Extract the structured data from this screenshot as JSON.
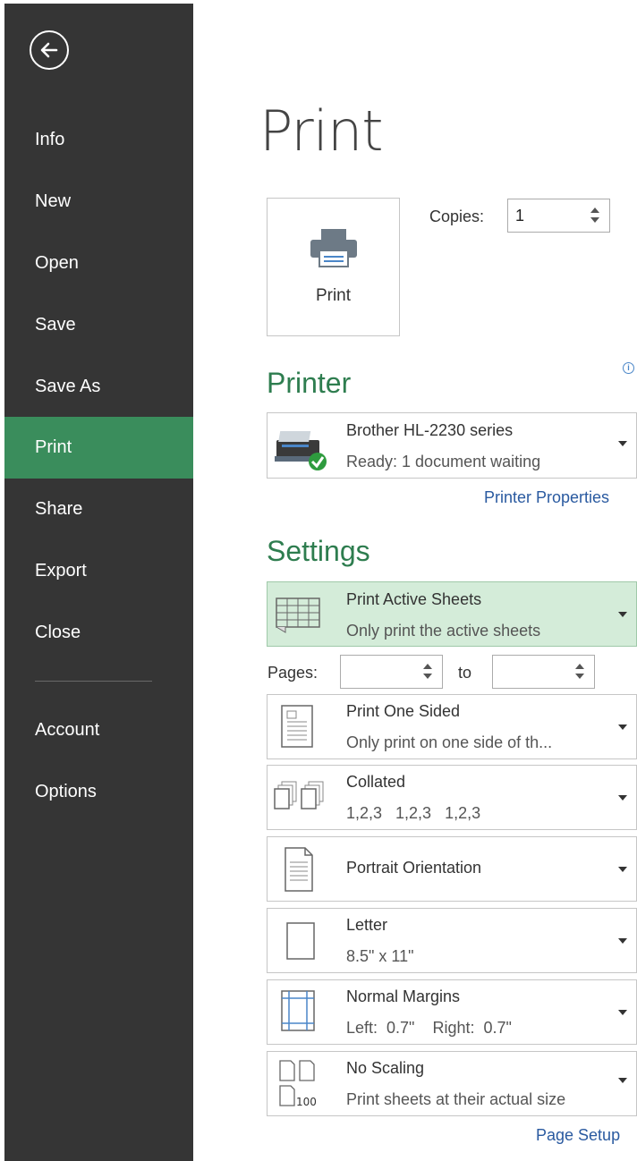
{
  "sidebar": {
    "items": [
      {
        "label": "Info"
      },
      {
        "label": "New"
      },
      {
        "label": "Open"
      },
      {
        "label": "Save"
      },
      {
        "label": "Save As"
      },
      {
        "label": "Print"
      },
      {
        "label": "Share"
      },
      {
        "label": "Export"
      },
      {
        "label": "Close"
      },
      {
        "label": "Account"
      },
      {
        "label": "Options"
      }
    ],
    "active": "Print"
  },
  "page": {
    "title": "Print"
  },
  "print_button": {
    "label": "Print"
  },
  "copies": {
    "label": "Copies:",
    "value": "1"
  },
  "printer": {
    "section_title": "Printer",
    "name": "Brother HL-2230 series",
    "status": "Ready: 1 document waiting",
    "properties_link": "Printer Properties"
  },
  "settings": {
    "section_title": "Settings",
    "active_sheets": {
      "title": "Print Active Sheets",
      "subtitle": "Only print the active sheets"
    },
    "pages": {
      "label": "Pages:",
      "to_label": "to",
      "from_value": "",
      "to_value": ""
    },
    "sided": {
      "title": "Print One Sided",
      "subtitle": "Only print on one side of th..."
    },
    "collated": {
      "title": "Collated",
      "subtitle": "1,2,3   1,2,3   1,2,3"
    },
    "orientation": {
      "title": "Portrait Orientation"
    },
    "paper": {
      "title": "Letter",
      "subtitle": "8.5\" x 11\""
    },
    "margins": {
      "title": "Normal Margins",
      "subtitle": "Left:  0.7\"    Right:  0.7\""
    },
    "scaling": {
      "title": "No Scaling",
      "subtitle": "Print sheets at their actual size",
      "icon_number": "100"
    },
    "page_setup_link": "Page Setup"
  },
  "colors": {
    "sidebar_bg": "#353535",
    "active_item": "#3a8d5c",
    "section_title": "#2e7d4f",
    "link": "#2a5aa0",
    "selected_row": "#d4ecd9"
  }
}
